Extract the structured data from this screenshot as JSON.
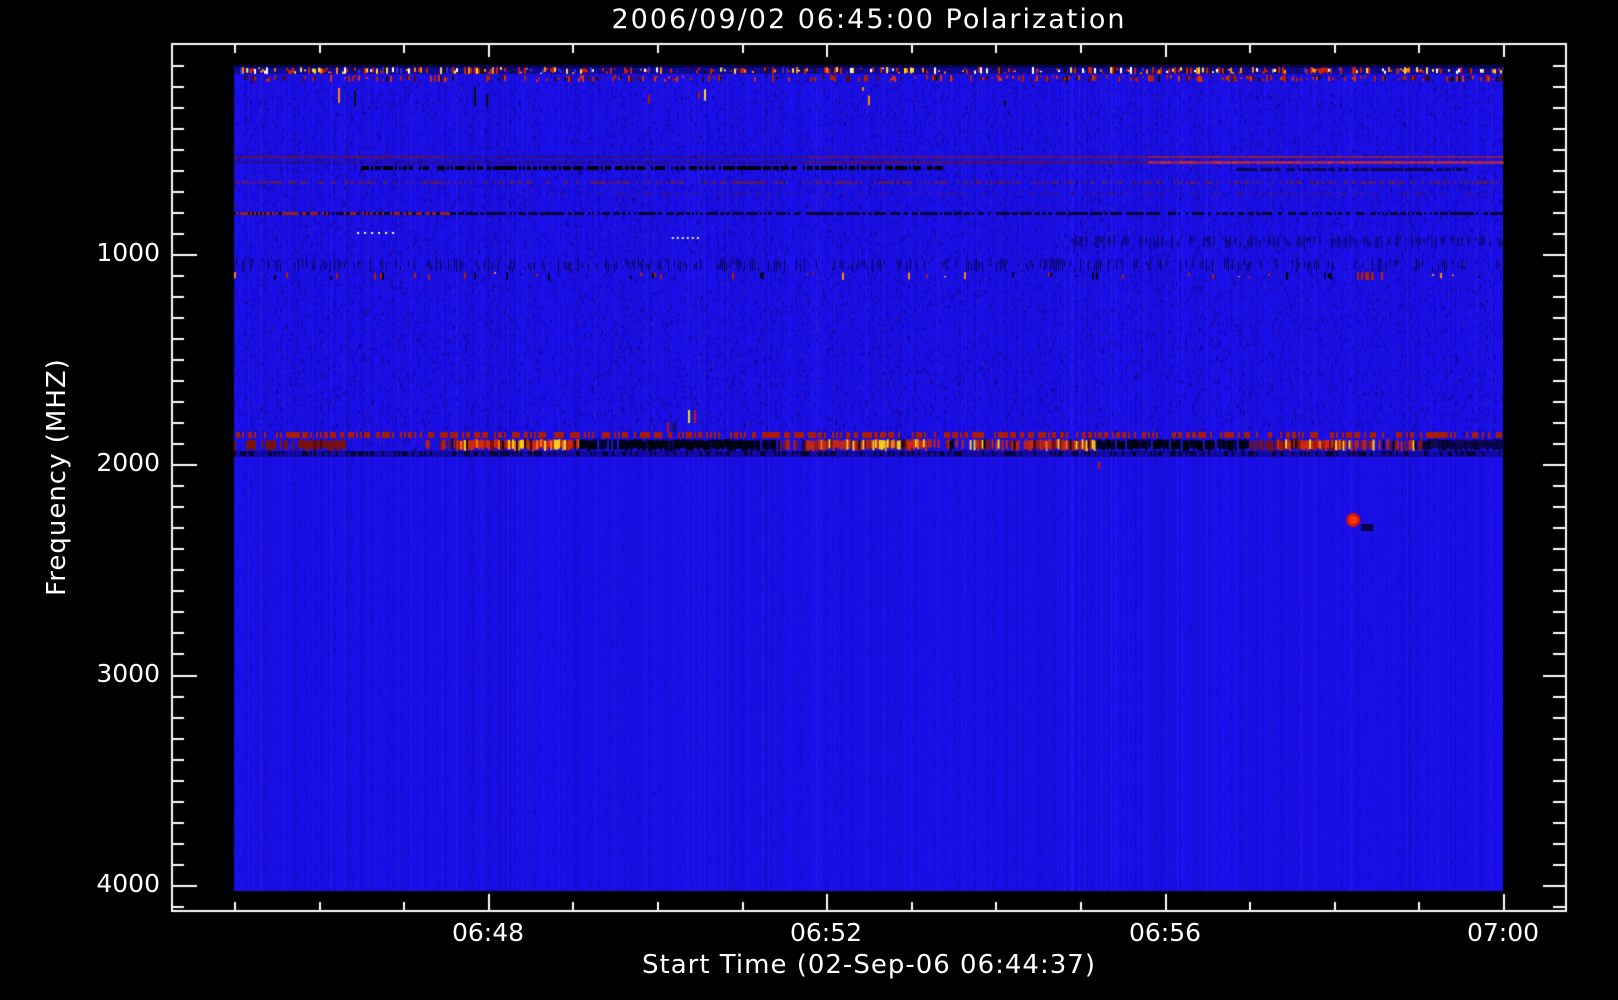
{
  "page": {
    "background": "#000000"
  },
  "chart_data": {
    "type": "heatmap",
    "title": "2006/09/02 06:45:00 Polarization",
    "xlabel": "Start Time (02-Sep-06 06:44:37)",
    "ylabel": "Frequency (MHZ)",
    "x_axis": {
      "start_time": "06:45:00",
      "end_time": "07:00:00",
      "range_minutes": [
        0,
        15
      ],
      "major_tick_minutes": [
        3,
        7,
        11,
        15
      ],
      "major_tick_labels": [
        "06:48",
        "06:52",
        "06:56",
        "07:00"
      ],
      "minor_tick_step_minutes": 1
    },
    "y_axis": {
      "range_mhz": [
        100,
        4030
      ],
      "major_tick_values": [
        1000,
        2000,
        3000,
        4000
      ],
      "major_tick_labels": [
        "1000",
        "2000",
        "3000",
        "4000"
      ],
      "minor_tick_step_mhz": 100,
      "direction": "increasing-downward"
    },
    "legend": "none",
    "grid": "off",
    "colors": {
      "background_blue": "#1c11f2",
      "axis": "#ffffff",
      "text": "#ffffff",
      "bright_red": "#d82806",
      "orange": "#f07b10",
      "yellow": "#ffd818",
      "dark_red": "#7a1208",
      "black": "#000000",
      "navy": "#06033a",
      "white": "#ffffff"
    },
    "features": {
      "noise": {
        "seed": 90602,
        "upper_dash_count": 30000,
        "lower_dash_count": 9000,
        "upper_lower_boundary_fy": 0.47
      },
      "rows": [
        {
          "name": "top-dark-edge",
          "fy": 0.0,
          "h": 3,
          "style": "solid",
          "color": "#04023a",
          "alpha": 0.85,
          "fx0": 0,
          "fx1": 1
        },
        {
          "name": "top-speckle-1",
          "fy": 0.0024,
          "h": 7,
          "style": "speckle",
          "base": "#0a0560",
          "palette": [
            "#cc2200",
            "#ff8800",
            "#ffd833",
            "#ffffff",
            "#111111",
            "#3a2bd6"
          ],
          "density": 0.5,
          "fx0": 0,
          "fx1": 1
        },
        {
          "name": "top-speckle-2",
          "fy": 0.0121,
          "h": 7,
          "style": "speckle",
          "palette": [
            "#b81f00",
            "#e03010",
            "#550a05",
            "#111111"
          ],
          "density": 0.22,
          "density2": 0.5,
          "fx0": 0,
          "fx1": 1
        },
        {
          "name": "sparse-specks",
          "fy": 0.0254,
          "h": 22,
          "style": "speckle",
          "palette": [
            "#aa1b00",
            "#ff8800",
            "#111111",
            "#ffd833"
          ],
          "density": 0.018,
          "fx0": 0,
          "fx1": 1
        },
        {
          "name": "red-line-a",
          "fy": 0.1101,
          "h": 2,
          "style": "segline",
          "segs": [
            [
              0.0,
              0.17,
              "#7a150c",
              0.85
            ],
            [
              0.17,
              0.45,
              "#5c0f08",
              0.5
            ],
            [
              0.45,
              0.72,
              "#8a1a0c",
              0.7
            ],
            [
              0.72,
              1.0,
              "#c22405",
              0.95
            ]
          ]
        },
        {
          "name": "red-line-b",
          "fy": 0.1162,
          "h": 3,
          "style": "segline",
          "segs": [
            [
              0.0,
              0.45,
              "#4a0c06",
              0.35
            ],
            [
              0.45,
              0.72,
              "#7a150c",
              0.6
            ],
            [
              0.72,
              1.0,
              "#e23608",
              0.95
            ]
          ]
        },
        {
          "name": "black-dash-line",
          "fy": 0.1223,
          "h": 4,
          "style": "dash",
          "color": "#000000",
          "density": 0.7,
          "fx0": 0.1,
          "fx1": 0.56
        },
        {
          "name": "navy-dash-right",
          "fy": 0.1247,
          "h": 3,
          "style": "dash",
          "color": "#0a0540",
          "density": 0.75,
          "fx0": 0.79,
          "fx1": 0.97
        },
        {
          "name": "red-brown-line",
          "fy": 0.1404,
          "h": 3,
          "style": "dash",
          "color": "#8a2010",
          "density": 0.5,
          "alpha": 0.55,
          "fx0": 0,
          "fx1": 1
        },
        {
          "name": "faint-red-line",
          "fy": 0.155,
          "h": 2,
          "style": "dash",
          "color": "#7a1a10",
          "density": 0.35,
          "alpha": 0.45,
          "fx0": 0.25,
          "fx1": 1
        },
        {
          "name": "navy-line",
          "fy": 0.178,
          "h": 3,
          "style": "dash",
          "color": "#08043c",
          "density": 0.7,
          "fx0": 0,
          "fx1": 1
        },
        {
          "name": "navy-line-left-red",
          "fy": 0.178,
          "h": 3,
          "style": "dash",
          "color": "#992211",
          "density": 0.55,
          "fx0": 0,
          "fx1": 0.17
        },
        {
          "name": "white-dots-1",
          "fy": 0.2022,
          "h": 2,
          "style": "dots",
          "color": "#ffffff",
          "step": 7,
          "fx0": 0.097,
          "fx1": 0.127
        },
        {
          "name": "white-dots-2",
          "fy": 0.2082,
          "h": 2,
          "style": "dots",
          "color": "#e8e8ff",
          "step": 5,
          "fx0": 0.345,
          "fx1": 0.366
        },
        {
          "name": "navy-texture-right",
          "fy": 0.2058,
          "h": 13,
          "style": "vdash",
          "color": "#0a0550",
          "density": 0.5,
          "fx0": 0.66,
          "fx1": 1
        },
        {
          "name": "navy-texture-full",
          "fy": 0.2337,
          "h": 14,
          "style": "vdash",
          "color": "#0a0550",
          "density": 0.38,
          "fx0": 0,
          "fx1": 1
        },
        {
          "name": "speckle-row-mid",
          "fy": 0.2506,
          "h": 8,
          "style": "speckle",
          "palette": [
            "#b02000",
            "#000000",
            "#07033a",
            "#ff8800"
          ],
          "density": 0.09,
          "fx0": 0,
          "fx1": 1
        },
        {
          "name": "speckle-row-cluster",
          "fy": 0.2506,
          "h": 8,
          "style": "dash",
          "color": "#c02000",
          "density": 0.5,
          "fx0": 0.885,
          "fx1": 0.905
        },
        {
          "name": "band-speckle-above",
          "fy": 0.4443,
          "h": 6,
          "style": "dash",
          "color": "#a81c08",
          "density": 0.5,
          "fx0": 0,
          "fx1": 1
        },
        {
          "name": "navy-row-below-band",
          "fy": 0.4673,
          "h": 6,
          "style": "solid",
          "color": "#0a0460",
          "alpha": 0.5,
          "fx0": 0,
          "fx1": 1
        },
        {
          "name": "navy-row-below-dash",
          "fy": 0.4673,
          "h": 5,
          "style": "dash",
          "color": "#06033a",
          "density": 0.4,
          "fx0": 0,
          "fx1": 1
        }
      ],
      "band": {
        "name": "interference-band-1900mhz",
        "fy": 0.454,
        "h": 10,
        "segments": [
          [
            0.0,
            0.06,
            "darkdash"
          ],
          [
            0.06,
            0.088,
            "darkred"
          ],
          [
            0.088,
            0.151,
            "skip"
          ],
          [
            0.151,
            0.175,
            "redspeckle"
          ],
          [
            0.175,
            0.272,
            "bright"
          ],
          [
            0.272,
            0.304,
            "blackblue"
          ],
          [
            0.304,
            0.41,
            "black"
          ],
          [
            0.41,
            0.43,
            "blackblue"
          ],
          [
            0.43,
            0.448,
            "redspeckle"
          ],
          [
            0.448,
            0.505,
            "bright"
          ],
          [
            0.505,
            0.545,
            "brightyellow"
          ],
          [
            0.545,
            0.627,
            "redspeckle2"
          ],
          [
            0.627,
            0.68,
            "bright"
          ],
          [
            0.68,
            0.8,
            "blackblue"
          ],
          [
            0.8,
            0.822,
            "darkdash"
          ],
          [
            0.822,
            0.872,
            "bright"
          ],
          [
            0.872,
            0.938,
            "redspeckle2"
          ],
          [
            0.938,
            1.0,
            "navyblack"
          ]
        ]
      },
      "marks": [
        {
          "type": "vline",
          "name": "yellow-tick",
          "fx": 0.3578,
          "fy": 0.4177,
          "w": 2,
          "h": 13,
          "color": "#e8e418"
        },
        {
          "type": "vline",
          "name": "red-tick-pair",
          "fx": 0.3625,
          "fy": 0.4177,
          "w": 2,
          "h": 13,
          "color": "#cc1505"
        },
        {
          "type": "vline",
          "name": "small-red-tick",
          "fx": 0.3412,
          "fy": 0.4322,
          "w": 2,
          "h": 10,
          "color": "#bb1505"
        },
        {
          "type": "vline",
          "name": "small-navy-tick",
          "fx": 0.346,
          "fy": 0.4322,
          "w": 3,
          "h": 10,
          "color": "#1a1060"
        },
        {
          "type": "vline",
          "name": "red-tick-below-band",
          "fx": 0.681,
          "fy": 0.4806,
          "w": 2,
          "h": 7,
          "color": "#cc1100"
        },
        {
          "type": "dot",
          "name": "red-point-source",
          "fx": 0.882,
          "fy": 0.5508,
          "r": 7,
          "color": "#d81802",
          "core": "#ff3808"
        },
        {
          "type": "spot",
          "name": "navy-spot",
          "fx": 0.893,
          "fy": 0.56,
          "w": 12,
          "h": 7,
          "color": "#070344"
        }
      ]
    }
  }
}
